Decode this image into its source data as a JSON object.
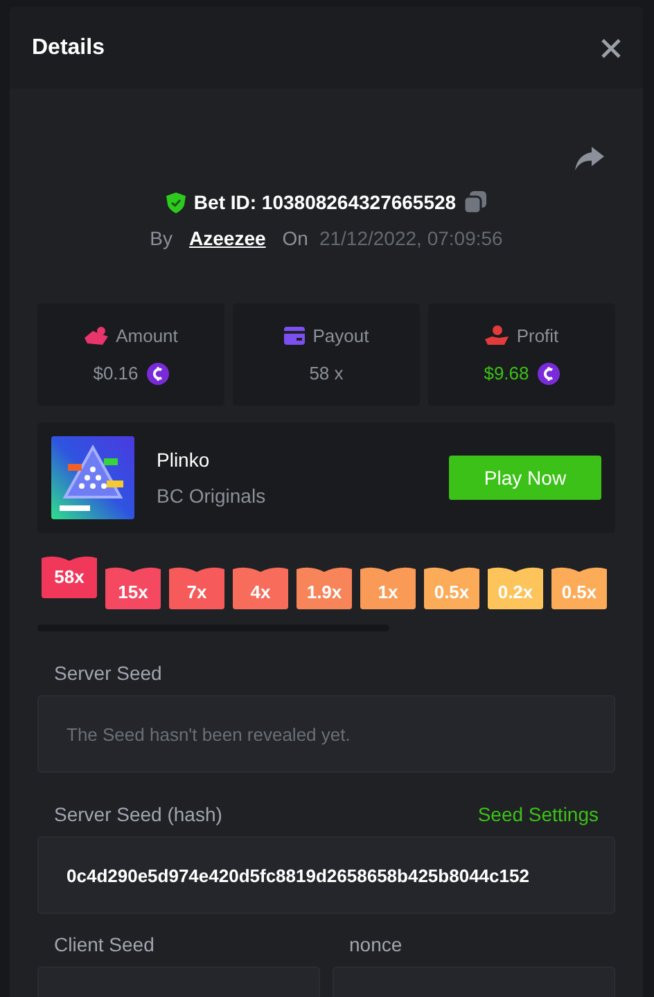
{
  "dialog": {
    "title": "Details"
  },
  "bet": {
    "id_label": "Bet ID: 103808264327665528",
    "by_label": "By",
    "user": "Azeezee",
    "on_label": "On",
    "date": "21/12/2022, 07:09:56"
  },
  "stats": [
    {
      "kind": "amount",
      "label": "Amount",
      "value": "$0.16",
      "coin": true,
      "positive": false
    },
    {
      "kind": "payout",
      "label": "Payout",
      "value": "58 x",
      "coin": false,
      "positive": false
    },
    {
      "kind": "profit",
      "label": "Profit",
      "value": "$9.68",
      "coin": true,
      "positive": true
    }
  ],
  "game": {
    "name": "Plinko",
    "provider": "BC Originals",
    "button": "Play Now"
  },
  "multipliers": [
    {
      "label": "58x",
      "color": "#f2385a",
      "selected": true
    },
    {
      "label": "15x",
      "color": "#f44961",
      "selected": false
    },
    {
      "label": "7x",
      "color": "#f65a5a",
      "selected": false
    },
    {
      "label": "4x",
      "color": "#f76c5a",
      "selected": false
    },
    {
      "label": "1.9x",
      "color": "#f8845a",
      "selected": false
    },
    {
      "label": "1x",
      "color": "#fa9a57",
      "selected": false
    },
    {
      "label": "0.5x",
      "color": "#fcab59",
      "selected": false
    },
    {
      "label": "0.2x",
      "color": "#fdc45c",
      "selected": false
    },
    {
      "label": "0.5x",
      "color": "#fcab59",
      "selected": false
    }
  ],
  "server_seed": {
    "label": "Server Seed",
    "placeholder": "The Seed hasn't been revealed yet."
  },
  "server_seed_hash": {
    "label": "Server Seed (hash)",
    "link": "Seed Settings",
    "value": "0c4d290e5d974e420d5fc8819d2658658b425b8044c152"
  },
  "client_seed": {
    "label": "Client Seed"
  },
  "nonce": {
    "label": "nonce"
  }
}
